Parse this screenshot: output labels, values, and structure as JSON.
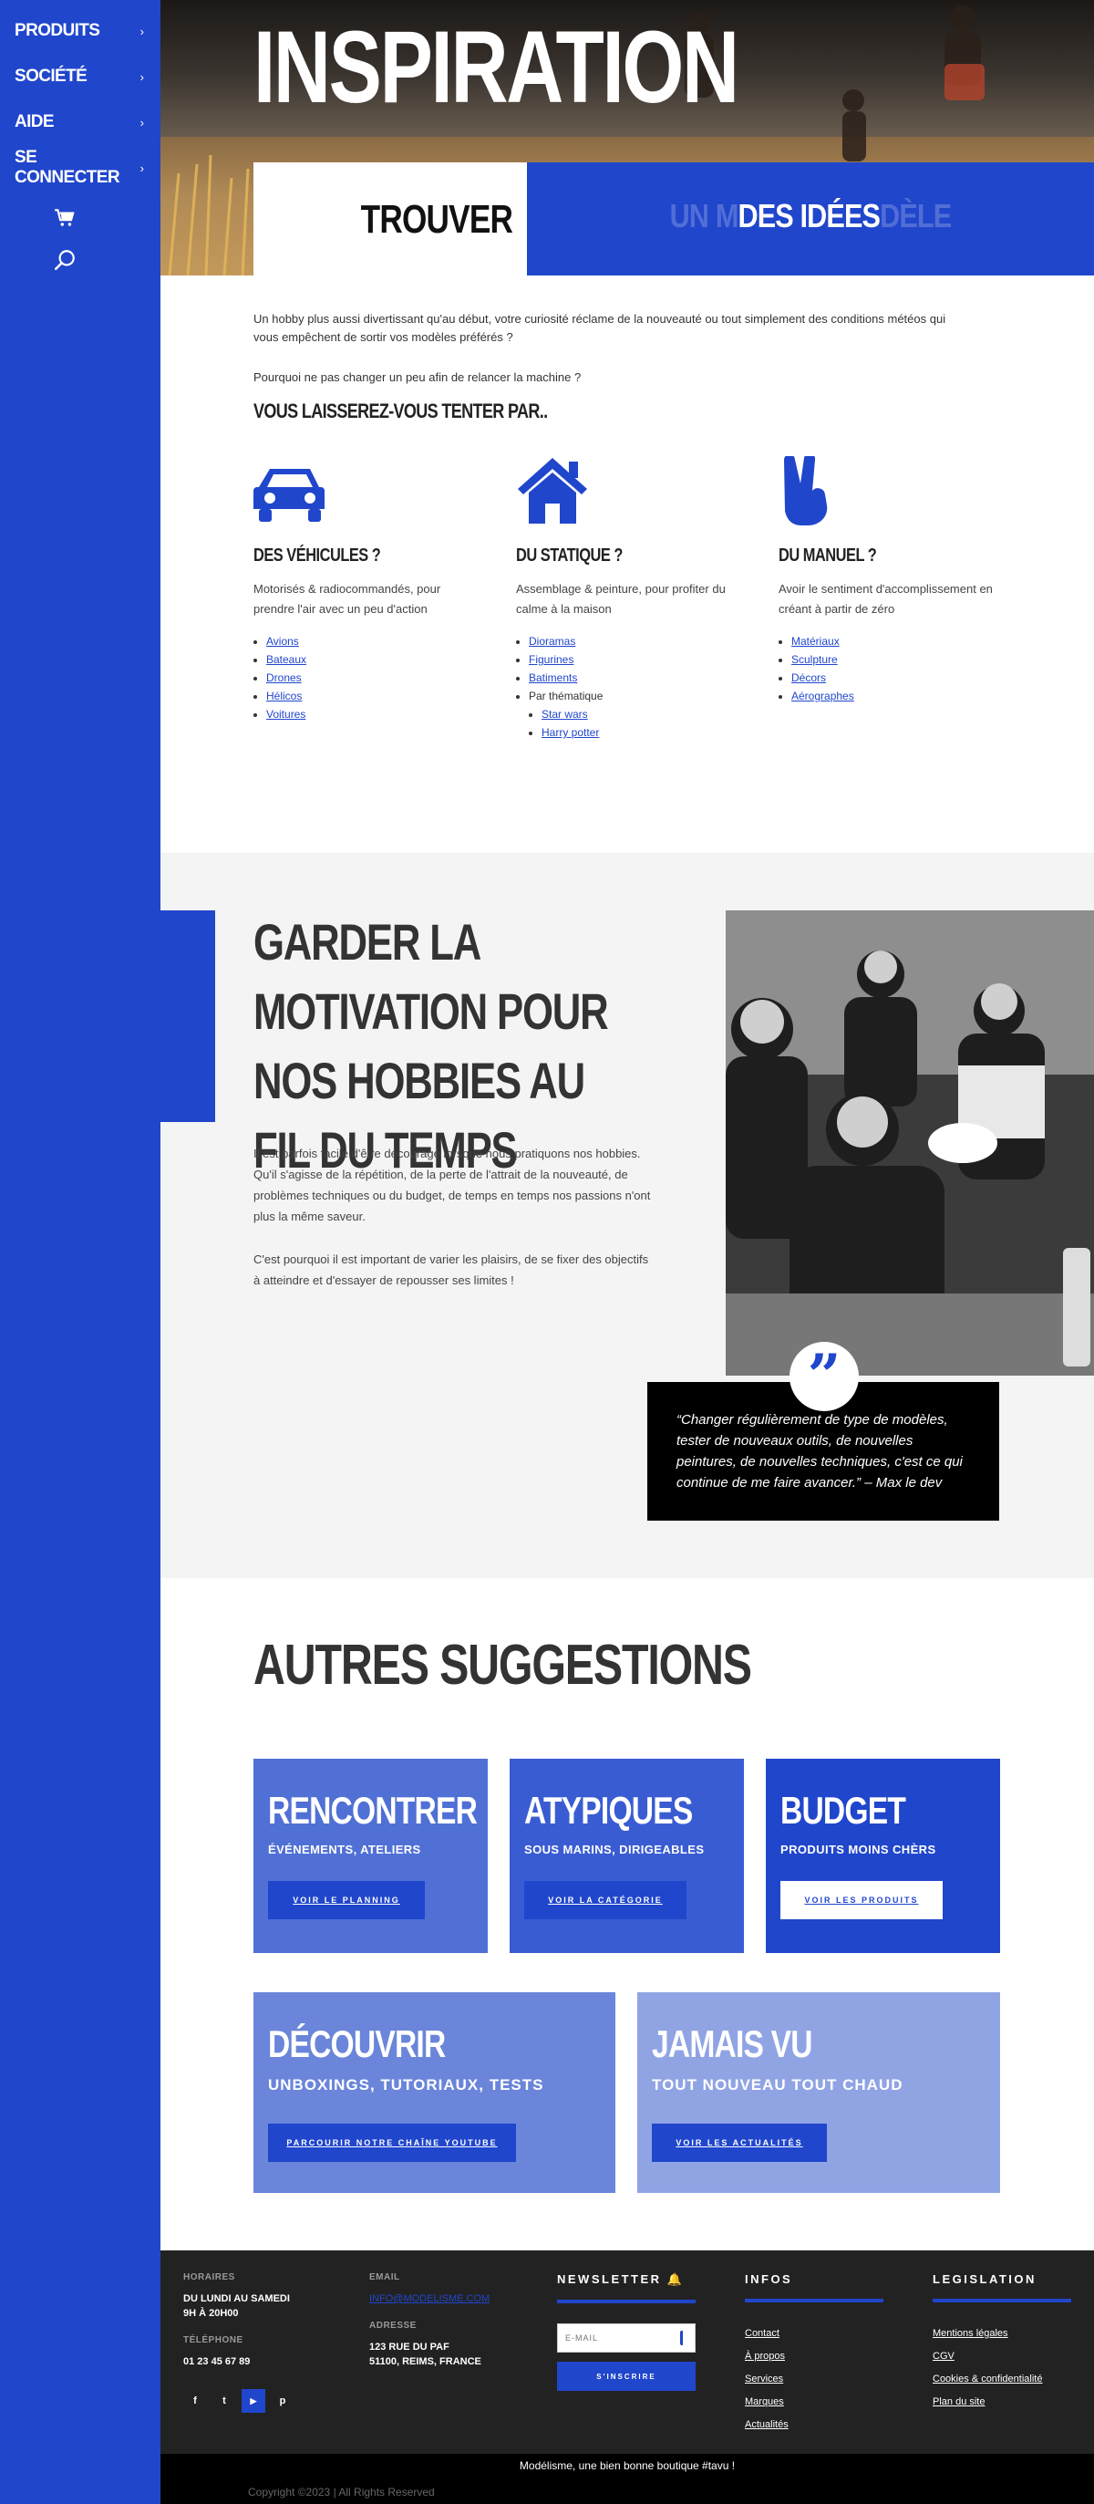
{
  "sidebar": {
    "items": [
      {
        "label": "PRODUITS"
      },
      {
        "label": "SOCIÉTÉ"
      },
      {
        "label": "AIDE"
      },
      {
        "label": "SE CONNECTER"
      }
    ],
    "cart_icon": "cart-icon",
    "search_icon": "search-icon"
  },
  "hero": {
    "title": "INSPIRATION",
    "find": "TROUVER",
    "ideas_prefix_ghost": "UN M",
    "ideas": "DES IDÉES",
    "ideas_suffix_ghost": "DÈLE"
  },
  "intro": {
    "p1": "Un hobby plus aussi divertissant qu'au début, votre curiosité réclame de la nouveauté ou tout simplement des conditions météos qui vous empêchent de sortir vos modèles préférés ?",
    "p2": "Pourquoi ne pas changer un peu afin de relancer la machine ?",
    "heading": "VOUS LAISSEREZ-VOUS TENTER PAR.."
  },
  "categories": [
    {
      "icon": "car-icon",
      "title": "DES VÉHICULES ?",
      "text": "Motorisés & radiocommandés, pour prendre l'air avec un peu d'action",
      "links": [
        "Avions",
        "Bateaux",
        "Drones",
        "Hélicos",
        "Voitures"
      ]
    },
    {
      "icon": "house-icon",
      "title": "DU STATIQUE ?",
      "text": "Assemblage & peinture, pour profiter du calme à la maison",
      "links": [
        "Dioramas",
        "Figurines",
        "Batiments"
      ],
      "theme_label": "Par thématique",
      "sub_links": [
        "Star wars",
        "Harry potter"
      ]
    },
    {
      "icon": "hand-icon",
      "title": "DU MANUEL ?",
      "text": "Avoir le sentiment d'accomplissement en créant à partir de zéro",
      "links": [
        "Matériaux",
        "Sculpture",
        "Décors",
        "Aérographes"
      ]
    }
  ],
  "motivation": {
    "title": "GARDER LA MOTIVATION POUR NOS HOBBIES AU FIL DU TEMPS",
    "p1": "Il est parfois facile d'être découragé lorsque nous pratiquons nos hobbies. Qu'il s'agisse de la répétition, de la perte de l'attrait de la nouveauté, de problèmes techniques ou du budget, de temps en temps nos passions n'ont plus la même saveur.",
    "p2": "C'est pourquoi il est important de varier les plaisirs, de se fixer des objectifs à atteindre et d'essayer de repousser ses limites !",
    "quote": "“Changer régulièrement de type de modèles, tester de nouveaux outils, de nouvelles peintures, de nouvelles techniques, c'est ce qui continue de me faire avancer.” – Max le dev"
  },
  "suggestions": {
    "title": "AUTRES SUGGESTIONS",
    "cards": [
      {
        "title": "RENCONTRER",
        "subtitle": "ÉVÉNEMENTS, ATELIERS",
        "button": "VOIR LE PLANNING",
        "color": "#5070d6"
      },
      {
        "title": "ATYPIQUES",
        "subtitle": "SOUS MARINS, DIRIGEABLES",
        "button": "VOIR LA CATÉGORIE",
        "color": "#3a5cd3"
      },
      {
        "title": "BUDGET",
        "subtitle": "PRODUITS MOINS CHÈRS",
        "button": "VOIR LES PRODUITS",
        "color": "#2046cc"
      },
      {
        "title": "DÉCOUVRIR",
        "subtitle": "UNBOXINGS, TUTORIAUX, TESTS",
        "button": "PARCOURIR NOTRE CHAÎNE YOUTUBE",
        "color": "#6a85da"
      },
      {
        "title": "JAMAIS VU",
        "subtitle": "TOUT NOUVEAU TOUT CHAUD",
        "button": "VOIR LES ACTUALITÉS",
        "color": "#90a4e4"
      }
    ]
  },
  "footer": {
    "hours_label": "HORAIRES",
    "hours_line1": "DU LUNDI AU SAMEDI",
    "hours_line2": "9H À 20H00",
    "phone_label": "TÉLÉPHONE",
    "phone": "01 23 45 67 89",
    "email_label": "EMAIL",
    "email": "INFO@MODELISME.COM",
    "address_label": "ADRESSE",
    "address_line1": "123 RUE DU PAF",
    "address_line2": "51100, REIMS, FRANCE",
    "newsletter_title": "NEWSLETTER 🔔",
    "newsletter_placeholder": "E-MAIL",
    "newsletter_button": "S'INSCRIRE",
    "infos_title": "INFOS",
    "infos_links": [
      "Contact",
      "À propos",
      "Services",
      "Marques",
      "Actualités"
    ],
    "legal_title": "LEGISLATION",
    "legal_links": [
      "Mentions légales",
      "CGV",
      "Cookies & confidentialité",
      "Plan du site"
    ],
    "socials": [
      "f",
      "t",
      "▶",
      "p"
    ],
    "slogan": "Modélisme, une bien bonne boutique #tavu !",
    "copyright": "Copyright ©2023 | All Rights Reserved"
  },
  "colors": {
    "brand_blue": "#2046cc",
    "dark": "#222222",
    "light_bg": "#f4f4f4"
  }
}
